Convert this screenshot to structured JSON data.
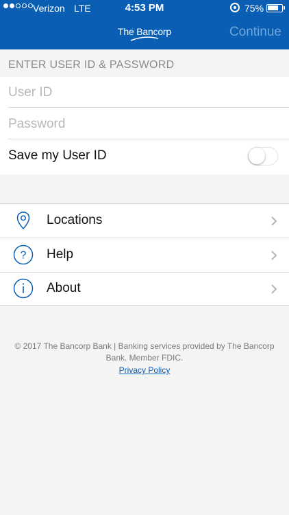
{
  "status_bar": {
    "carrier": "Verizon",
    "network": "LTE",
    "time": "4:53 PM",
    "battery_percent": "75%",
    "battery_level": 0.75,
    "signal_bars": [
      true,
      true,
      false,
      false,
      false
    ]
  },
  "header": {
    "logo_text": "The Bancorp",
    "continue_label": "Continue",
    "background_color": "#0a5fb4",
    "continue_color": "#6fa6dc"
  },
  "login": {
    "section_title": "ENTER USER ID & PASSWORD",
    "user_id_placeholder": "User ID",
    "user_id_value": "",
    "password_placeholder": "Password",
    "password_value": "",
    "save_user_label": "Save my User ID",
    "save_user_enabled": false
  },
  "menu": {
    "items": [
      {
        "label": "Locations",
        "icon": "location-pin-icon"
      },
      {
        "label": "Help",
        "icon": "question-circle-icon"
      },
      {
        "label": "About",
        "icon": "info-circle-icon"
      }
    ]
  },
  "footer": {
    "copyright": "© 2017 The Bancorp Bank | Banking services provided by The Bancorp Bank. Member FDIC.",
    "privacy_link": "Privacy Policy"
  }
}
